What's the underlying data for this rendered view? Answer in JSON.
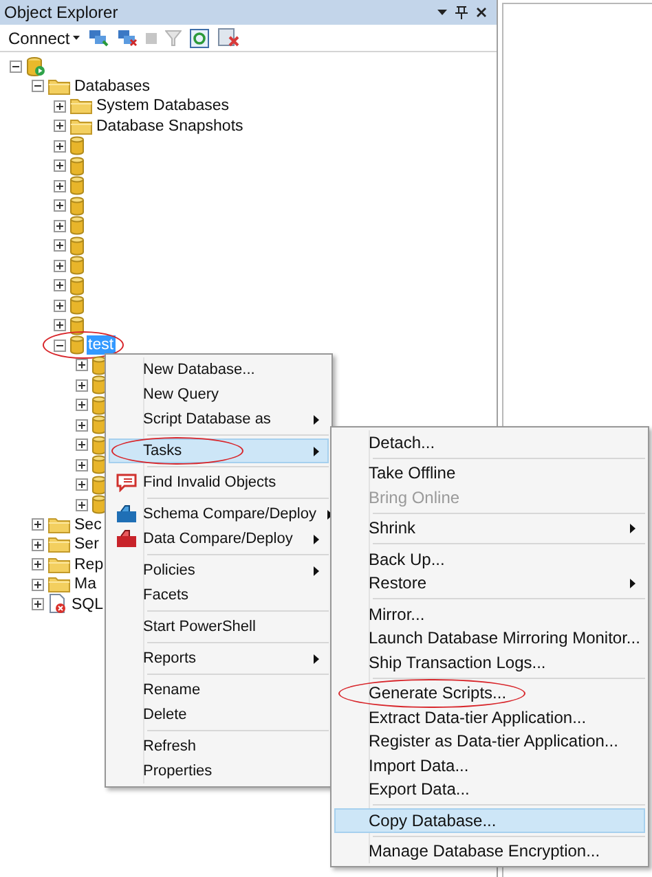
{
  "panel": {
    "title": "Object Explorer"
  },
  "toolbar": {
    "connect": "Connect"
  },
  "tree": [
    {
      "kind": "server",
      "expanded": true,
      "children": [
        {
          "kind": "folder",
          "label": "Databases",
          "expanded": true,
          "selected": false,
          "children": [
            {
              "kind": "folder",
              "label": "System Databases",
              "expanded": false,
              "selected": false
            },
            {
              "kind": "folder",
              "label": "Database Snapshots",
              "expanded": false,
              "selected": false
            },
            {
              "kind": "database",
              "expanded": false
            },
            {
              "kind": "database",
              "expanded": false
            },
            {
              "kind": "database",
              "expanded": false
            },
            {
              "kind": "database",
              "expanded": false
            },
            {
              "kind": "database",
              "expanded": false
            },
            {
              "kind": "database",
              "expanded": false
            },
            {
              "kind": "database",
              "expanded": false
            },
            {
              "kind": "database",
              "expanded": false
            },
            {
              "kind": "database",
              "expanded": false
            },
            {
              "kind": "database",
              "expanded": false
            },
            {
              "kind": "database",
              "label": "test",
              "expanded": true,
              "selected": true,
              "circled": true,
              "children": [
                {
                  "kind": "stub",
                  "expanded": false
                },
                {
                  "kind": "stub",
                  "expanded": false
                },
                {
                  "kind": "stub",
                  "expanded": false
                },
                {
                  "kind": "stub",
                  "expanded": false
                },
                {
                  "kind": "stub",
                  "expanded": false
                },
                {
                  "kind": "stub",
                  "expanded": false
                },
                {
                  "kind": "stub",
                  "expanded": false
                },
                {
                  "kind": "stub",
                  "expanded": false
                }
              ]
            }
          ]
        },
        {
          "kind": "folder",
          "label": "Sec",
          "expanded": false,
          "selected": false
        },
        {
          "kind": "folder",
          "label": "Ser",
          "expanded": false,
          "selected": false
        },
        {
          "kind": "folder",
          "label": "Rep",
          "expanded": false,
          "selected": false
        },
        {
          "kind": "folder",
          "label": "Ma",
          "expanded": false,
          "selected": false
        },
        {
          "kind": "agent",
          "label": "SQL",
          "expanded": false,
          "selected": false
        }
      ]
    }
  ],
  "context_menu": [
    {
      "kind": "item",
      "label": "New Database...",
      "submenu": false,
      "selected": false
    },
    {
      "kind": "item",
      "label": "New Query",
      "submenu": false,
      "selected": false
    },
    {
      "kind": "item",
      "label": "Script Database as",
      "submenu": true,
      "selected": false
    },
    {
      "kind": "separator"
    },
    {
      "kind": "item",
      "label": "Tasks",
      "submenu": true,
      "selected": true,
      "circled": true
    },
    {
      "kind": "separator"
    },
    {
      "kind": "item",
      "label": "Find Invalid Objects",
      "submenu": false,
      "selected": false
    },
    {
      "kind": "separator"
    },
    {
      "kind": "item",
      "label": "Schema Compare/Deploy",
      "submenu": true,
      "selected": false
    },
    {
      "kind": "item",
      "label": "Data Compare/Deploy",
      "submenu": true,
      "selected": false
    },
    {
      "kind": "separator"
    },
    {
      "kind": "item",
      "label": "Policies",
      "submenu": true,
      "selected": false
    },
    {
      "kind": "item",
      "label": "Facets",
      "submenu": false,
      "selected": false
    },
    {
      "kind": "separator"
    },
    {
      "kind": "item",
      "label": "Start PowerShell",
      "submenu": false,
      "selected": false
    },
    {
      "kind": "separator"
    },
    {
      "kind": "item",
      "label": "Reports",
      "submenu": true,
      "selected": false
    },
    {
      "kind": "separator"
    },
    {
      "kind": "item",
      "label": "Rename",
      "submenu": false,
      "selected": false
    },
    {
      "kind": "item",
      "label": "Delete",
      "submenu": false,
      "selected": false
    },
    {
      "kind": "separator"
    },
    {
      "kind": "item",
      "label": "Refresh",
      "submenu": false,
      "selected": false
    },
    {
      "kind": "item",
      "label": "Properties",
      "submenu": false,
      "selected": false
    }
  ],
  "tasks_submenu": [
    {
      "kind": "item",
      "label": "Detach...",
      "submenu": false,
      "disabled": false,
      "selected": false
    },
    {
      "kind": "separator"
    },
    {
      "kind": "item",
      "label": "Take Offline",
      "submenu": false,
      "disabled": false,
      "selected": false
    },
    {
      "kind": "item",
      "label": "Bring Online",
      "submenu": false,
      "disabled": true,
      "selected": false
    },
    {
      "kind": "separator"
    },
    {
      "kind": "item",
      "label": "Shrink",
      "submenu": true,
      "disabled": false,
      "selected": false
    },
    {
      "kind": "separator"
    },
    {
      "kind": "item",
      "label": "Back Up...",
      "submenu": false,
      "disabled": false,
      "selected": false
    },
    {
      "kind": "item",
      "label": "Restore",
      "submenu": true,
      "disabled": false,
      "selected": false
    },
    {
      "kind": "separator"
    },
    {
      "kind": "item",
      "label": "Mirror...",
      "submenu": false,
      "disabled": false,
      "selected": false
    },
    {
      "kind": "item",
      "label": "Launch Database Mirroring Monitor...",
      "submenu": false,
      "disabled": false,
      "selected": false
    },
    {
      "kind": "item",
      "label": "Ship Transaction Logs...",
      "submenu": false,
      "disabled": false,
      "selected": false
    },
    {
      "kind": "separator"
    },
    {
      "kind": "item",
      "label": "Generate Scripts...",
      "submenu": false,
      "disabled": false,
      "selected": false,
      "circled": true
    },
    {
      "kind": "item",
      "label": "Extract Data-tier Application...",
      "submenu": false,
      "disabled": false,
      "selected": false
    },
    {
      "kind": "item",
      "label": "Register as Data-tier Application...",
      "submenu": false,
      "disabled": false,
      "selected": false
    },
    {
      "kind": "item",
      "label": "Import Data...",
      "submenu": false,
      "disabled": false,
      "selected": false
    },
    {
      "kind": "item",
      "label": "Export Data...",
      "submenu": false,
      "disabled": false,
      "selected": false
    },
    {
      "kind": "separator"
    },
    {
      "kind": "item",
      "label": "Copy Database...",
      "submenu": false,
      "disabled": false,
      "selected": true
    },
    {
      "kind": "separator"
    },
    {
      "kind": "item",
      "label": "Manage Database Encryption...",
      "submenu": false,
      "disabled": false,
      "selected": false
    }
  ]
}
